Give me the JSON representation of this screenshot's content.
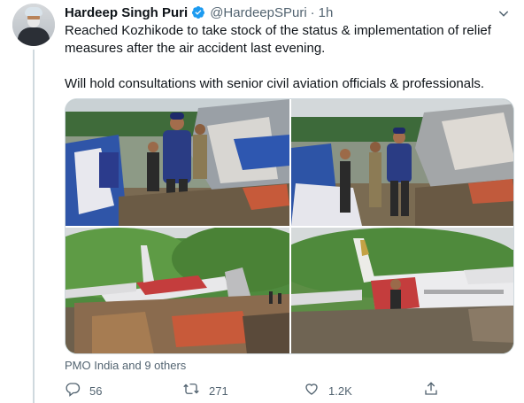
{
  "tweet": {
    "author": {
      "name": "Hardeep Singh Puri",
      "handle": "@HardeepSPuri",
      "verified": true
    },
    "separator": "·",
    "time": "1h",
    "text_lines": [
      "Reached Kozhikode to take stock of the status & implementation of relief measures after the air accident last evening.",
      "Will hold consultations with senior civil aviation officials & professionals."
    ],
    "liked_by": "PMO India and 9 others",
    "stats": {
      "replies": "56",
      "retweets": "271",
      "likes": "1.2K"
    }
  },
  "colors": {
    "verified": "#1d9bf0",
    "secondary_text": "#536471",
    "line": "#cfd9de"
  },
  "icons": [
    "verified-badge-icon",
    "chevron-down-icon",
    "reply-icon",
    "retweet-icon",
    "like-icon",
    "share-icon"
  ]
}
